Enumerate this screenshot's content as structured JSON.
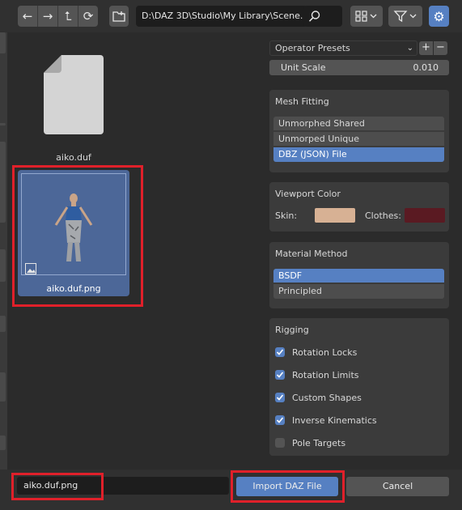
{
  "toolbar": {
    "nav_icons": [
      "arrow-left-icon",
      "arrow-right-icon",
      "parent-directory-icon",
      "refresh-icon"
    ],
    "path": "D:\\DAZ 3D\\Studio\\My Library\\Scene..."
  },
  "files": [
    {
      "name": "aiko.duf",
      "type": "document"
    },
    {
      "name": "aiko.duf.png",
      "type": "image",
      "selected": true
    }
  ],
  "operator_presets": {
    "label": "Operator Presets",
    "add": "+",
    "remove": "−"
  },
  "unit_scale": {
    "label": "Unit Scale",
    "value": "0.010"
  },
  "mesh_fitting": {
    "title": "Mesh Fitting",
    "options": [
      "Unmorphed Shared",
      "Unmorped Unique",
      "DBZ (JSON) File"
    ],
    "selected": "DBZ (JSON) File"
  },
  "viewport_color": {
    "title": "Viewport Color",
    "skin_label": "Skin:",
    "skin_color": "#d7b194",
    "clothes_label": "Clothes:",
    "clothes_color": "#5a1a22"
  },
  "material_method": {
    "title": "Material Method",
    "options": [
      "BSDF",
      "Principled"
    ],
    "selected": "BSDF"
  },
  "rigging": {
    "title": "Rigging",
    "options": [
      {
        "label": "Rotation Locks",
        "checked": true
      },
      {
        "label": "Rotation Limits",
        "checked": true
      },
      {
        "label": "Custom Shapes",
        "checked": true
      },
      {
        "label": "Inverse Kinematics",
        "checked": true
      },
      {
        "label": "Pole Targets",
        "checked": false
      }
    ]
  },
  "bottom": {
    "filename": "aiko.duf.png",
    "import_label": "Import DAZ File",
    "cancel_label": "Cancel"
  },
  "colors": {
    "accent": "#5680c2",
    "highlight": "#e0202a",
    "selected_file_bg": "#4c6798"
  }
}
